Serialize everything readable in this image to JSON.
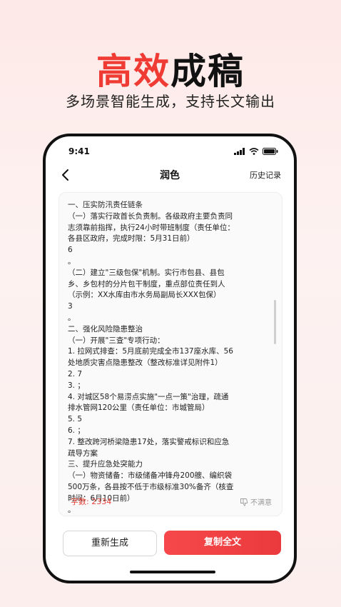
{
  "hero": {
    "title_red": "高效",
    "title_black": "成稿",
    "subtitle": "多场景智能生成，支持长文输出"
  },
  "status_bar": {
    "time": "9:41"
  },
  "nav": {
    "title": "润色",
    "history": "历史记录"
  },
  "content_lines": [
    "一、压实防汛责任链条",
    "（一）落实行政首长负责制。各级政府主要负责同",
    "志须靠前指挥，执行24小时带班制度（责任单位：",
    "各县区政府，完成时限：5月31日前）",
    "6",
    "。",
    "（二）建立\"三级包保\"机制。实行市包县、县包",
    "乡、乡包村的分片包干制度，重点部位责任到人",
    "（示例：XX水库由市水务局副局长XXX包保）",
    "3",
    "。",
    "二、强化风险隐患整治",
    "（一）开展\"三查\"专项行动：",
    "1. 拉网式排查：5月底前完成全市137座水库、56",
    "    处地质灾害点隐患整改（整改标准详见附件1）",
    "2. 7",
    "3. ；",
    "4. 对城区58个易涝点实施\"一点一策\"治理，疏通",
    "    排水管网120公里（责任单位：市城管局）",
    "5. 5",
    "6. ；",
    "7. 整改跨河桥梁隐患17处，落实警戒标识和应急",
    "    疏导方案",
    "三、提升应急处突能力",
    "（一）物资储备：市级储备冲锋舟200艘、编织袋",
    "500万条，各县按不低于市级标准30%备齐（核查",
    "时间：6月10日前）",
    "。"
  ],
  "footer": {
    "word_count": "字数: 2334",
    "unsatisfied": "不满意"
  },
  "buttons": {
    "regenerate": "重新生成",
    "copy_all": "复制全文"
  },
  "colors": {
    "accent": "#ef3b33"
  }
}
